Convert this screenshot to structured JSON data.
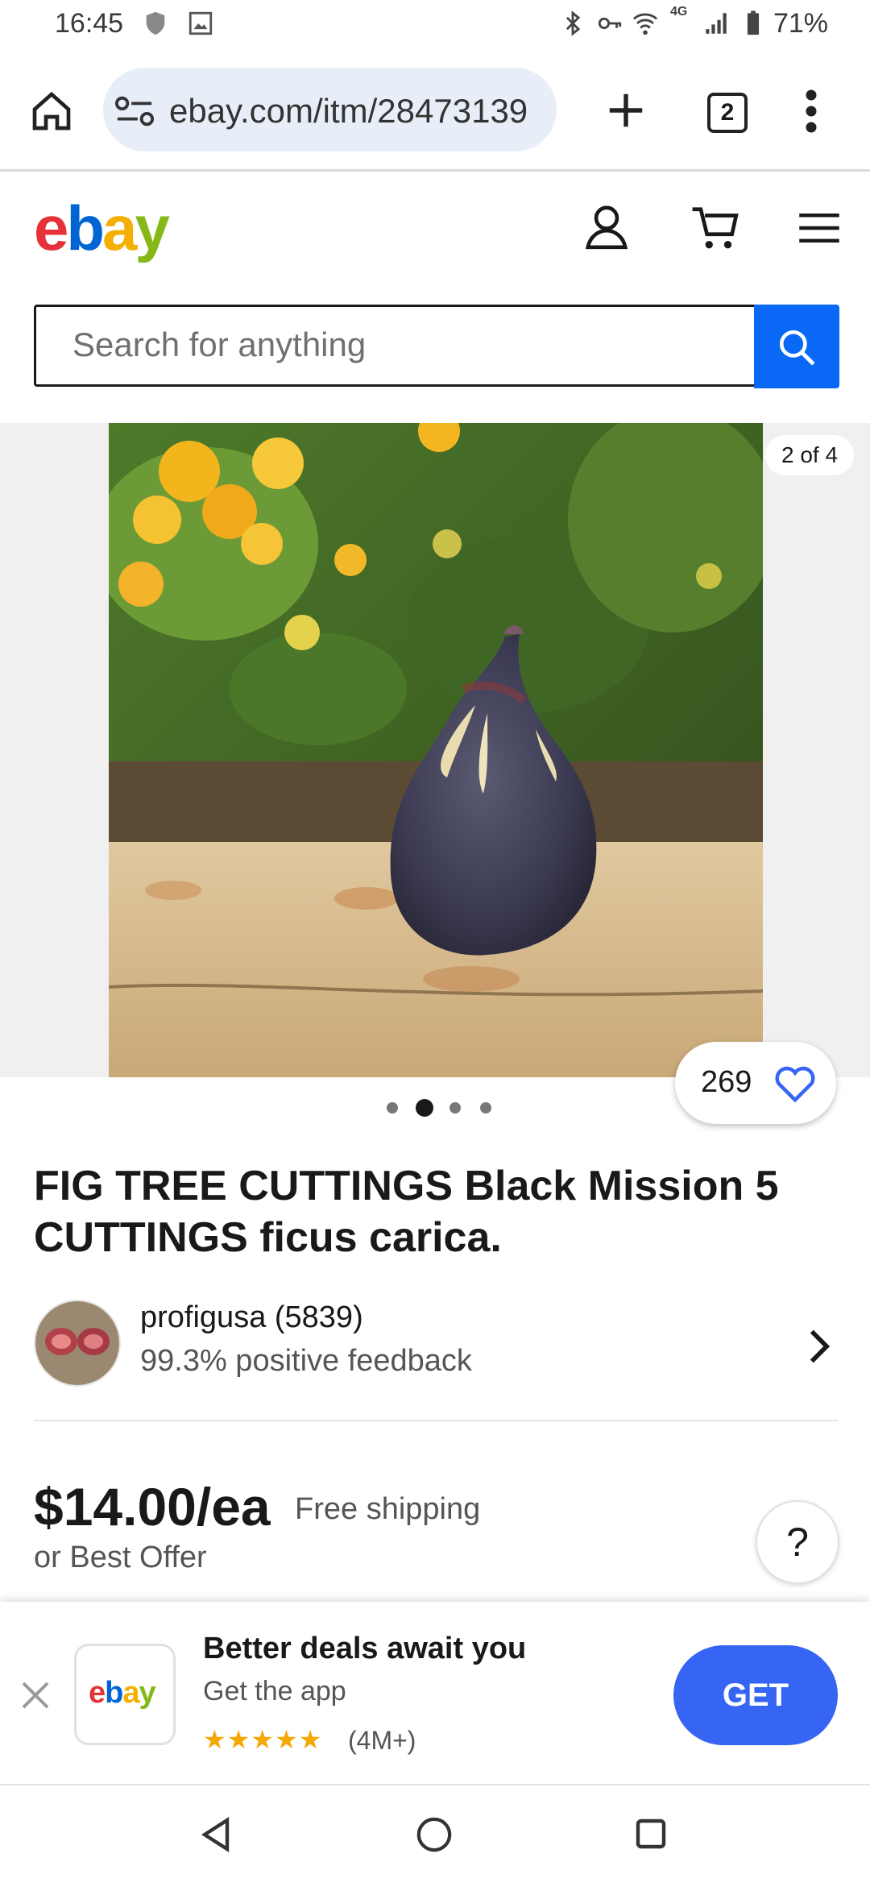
{
  "status_bar": {
    "time": "16:45",
    "battery": "71%",
    "network": "4G"
  },
  "browser": {
    "url": "ebay.com/itm/28473139",
    "tab_count": "2"
  },
  "header": {
    "logo_letters": [
      "e",
      "b",
      "a",
      "y"
    ],
    "logo_colors": [
      "#e53238",
      "#0064d2",
      "#f5af02",
      "#86b817"
    ]
  },
  "search": {
    "placeholder": "Search for anything"
  },
  "gallery": {
    "counter": "2 of 4",
    "watch_count": "269",
    "dots": 4,
    "active_dot": 1
  },
  "listing": {
    "title": "FIG TREE CUTTINGS Black Mission  5 CUTTINGS ficus carica."
  },
  "seller": {
    "name": "profigusa (5839)",
    "feedback": "99.3% positive feedback"
  },
  "pricing": {
    "price": "$14.00/ea",
    "shipping": "Free shipping",
    "offer": "or Best Offer"
  },
  "help": {
    "label": "?"
  },
  "banner": {
    "title": "Better deals await you",
    "subtitle": "Get the app",
    "stars": "★★★★★",
    "rating_count": "(4M+)",
    "get_label": "GET",
    "app_logo": "ebay"
  },
  "colors": {
    "accent": "#3665f3",
    "search_button": "#0968f6",
    "star": "#f3a900"
  }
}
